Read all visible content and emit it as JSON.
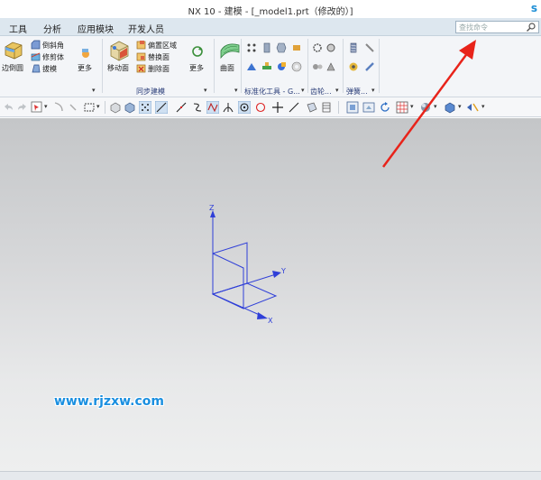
{
  "window": {
    "title": "NX 10 - 建模 - [_model1.prt（修改的）]",
    "corner_letter": "s"
  },
  "menu": {
    "items": [
      "工具",
      "分析",
      "应用模块",
      "开发人员"
    ]
  },
  "search": {
    "placeholder": "查找命令"
  },
  "ribbon": {
    "big": {
      "edge_blend": "边倒圆",
      "move_face": "移动面",
      "curved_surface": "曲面"
    },
    "small": {
      "chamfer": "倒斜角",
      "trim_body": "修剪体",
      "draft": "拔模",
      "offset_region": "偏置区域",
      "replace_face": "替换面",
      "delete_face": "删除面"
    },
    "more": [
      "更多",
      "更多",
      "更多"
    ],
    "groups": {
      "sync_modeling": "同步建模",
      "standard_tools": "标准化工具 - G...",
      "gear": "齿轮...",
      "spring": "弹簧..."
    }
  },
  "axes": {
    "z": "Z",
    "y": "Y",
    "x": "X",
    "color": "#2f3fd8"
  },
  "watermark": {
    "text": "www.rjzxw.com",
    "color": "#1a8fe0"
  },
  "annotation": {
    "arrow_color": "#e8231a"
  }
}
